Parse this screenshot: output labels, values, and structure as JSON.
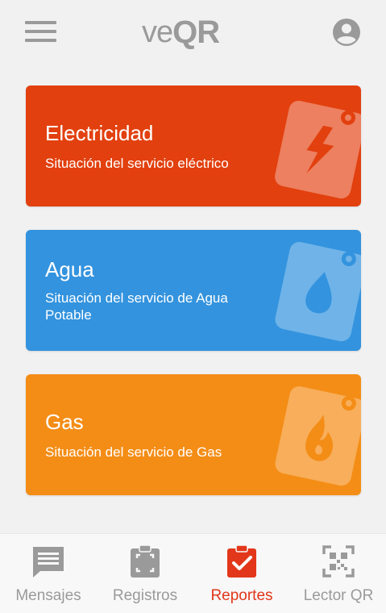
{
  "header": {
    "logo_prefix": "ve",
    "logo_suffix": "QR"
  },
  "cards": [
    {
      "title": "Electricidad",
      "subtitle": "Situación del servicio eléctrico",
      "color": "#e2400e",
      "icon": "electricity-tag-icon"
    },
    {
      "title": "Agua",
      "subtitle": "Situación del servicio de Agua Potable",
      "color": "#3393de",
      "icon": "water-tag-icon"
    },
    {
      "title": "Gas",
      "subtitle": "Situación del servicio de Gas",
      "color": "#f48d16",
      "icon": "gas-tag-icon"
    }
  ],
  "tabs": [
    {
      "label": "Mensajes",
      "icon": "messages-icon",
      "active": false
    },
    {
      "label": "Registros",
      "icon": "clipboard-scan-icon",
      "active": false
    },
    {
      "label": "Reportes",
      "icon": "clipboard-check-icon",
      "active": true
    },
    {
      "label": "Lector QR",
      "icon": "qr-reader-icon",
      "active": false
    }
  ],
  "colors": {
    "background": "#f1f1f1",
    "inactive": "#9a9a9a",
    "accent": "#e2371a"
  }
}
